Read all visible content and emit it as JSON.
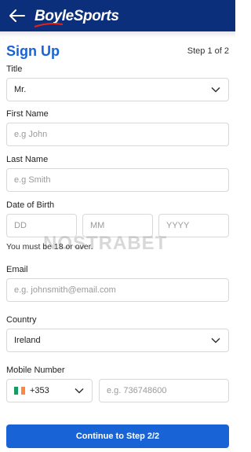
{
  "header": {
    "logo_part1": "Boyle",
    "logo_part2": "Sports",
    "back_icon": "arrow-left-icon"
  },
  "page": {
    "title": "Sign Up",
    "step": "Step 1 of 2"
  },
  "form": {
    "title_label": "Title",
    "title_value": "Mr.",
    "first_name_label": "First Name",
    "first_name_placeholder": "e.g John",
    "last_name_label": "Last Name",
    "last_name_placeholder": "e.g Smith",
    "dob_label": "Date of Birth",
    "dob_day_placeholder": "DD",
    "dob_month_placeholder": "MM",
    "dob_year_placeholder": "YYYY",
    "dob_hint": "You must be 18 or over.",
    "email_label": "Email",
    "email_placeholder": "e.g. johnsmith@email.com",
    "country_label": "Country",
    "country_value": "Ireland",
    "mobile_label": "Mobile Number",
    "country_code": "+353",
    "phone_placeholder": "e.g. 736748600"
  },
  "cta": {
    "label": "Continue to Step 2/2"
  },
  "watermark": "NOSTRABET",
  "colors": {
    "header_bg": "#0b2f7a",
    "accent": "#1864d6",
    "logo_red": "#e2231a"
  }
}
